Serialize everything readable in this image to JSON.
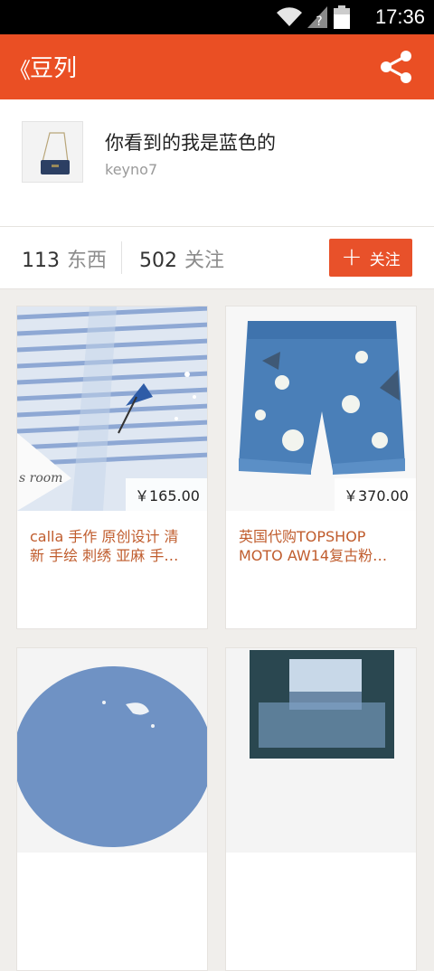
{
  "status_bar": {
    "time": "17:36",
    "battery": "39"
  },
  "app_bar": {
    "back_label": "《",
    "title": "豆列",
    "share_icon": "share-icon"
  },
  "collection": {
    "name": "你看到的我是蓝色的",
    "owner": "keyno7"
  },
  "stats": {
    "items_count": "113",
    "items_label": "东西",
    "followers_count": "502",
    "followers_label": "关注",
    "follow_button": {
      "icon": "+",
      "label": "关注"
    }
  },
  "items": [
    {
      "price": "￥165.00",
      "desc_line1": "calla 手作 原创设计 清",
      "desc_line2": "新 手绘 刺绣 亚麻 手…",
      "watermark": "s room"
    },
    {
      "price": "￥370.00",
      "desc_line1": "英国代购TOPSHOP",
      "desc_line2": "MOTO AW14复古粉…"
    },
    {
      "price": "",
      "desc_line1": "",
      "desc_line2": ""
    },
    {
      "price": "",
      "desc_line1": "",
      "desc_line2": ""
    }
  ],
  "colors": {
    "accent": "#ea4f24",
    "status_bar": "#000000",
    "desc_text": "#c05d2e"
  }
}
